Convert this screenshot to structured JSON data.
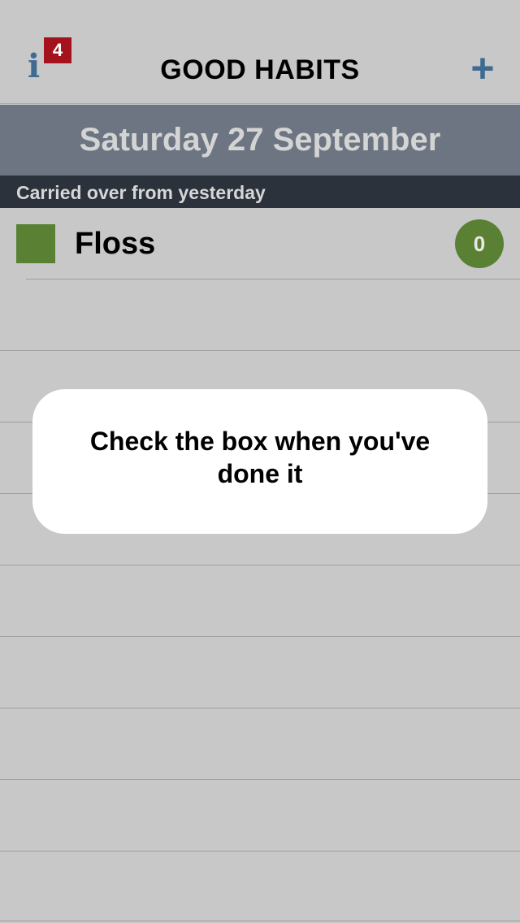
{
  "header": {
    "info_icon": "i",
    "info_badge_count": "4",
    "title": "GOOD HABITS",
    "add_icon": "+"
  },
  "date_band": {
    "date": "Saturday 27 September"
  },
  "section": {
    "title": "Carried over from yesterday"
  },
  "habits": [
    {
      "name": "Floss",
      "count": "0",
      "checked": false
    }
  ],
  "tooltip": {
    "text": "Check the box when you've done it"
  },
  "colors": {
    "background": "#c8c8c8",
    "accent_blue": "#3f6a91",
    "badge_red": "#a4121e",
    "date_band": "#6c7581",
    "section_header": "#2b323c",
    "habit_green": "#5a8133"
  }
}
